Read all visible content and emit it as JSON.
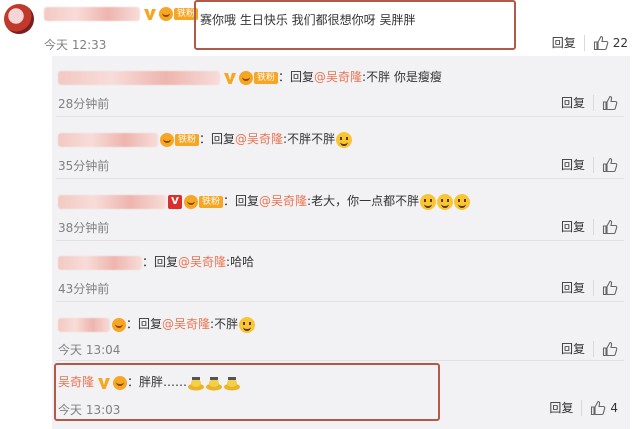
{
  "main_comment": {
    "username": "独上…",
    "text": "赛你哦 生日快乐 我们都很想你呀 吴胖胖",
    "time": "今天 12:33",
    "reply_label": "回复",
    "likes": "22"
  },
  "replies": [
    {
      "prefix": "：回复",
      "target": "@吴奇隆",
      "text": ":不胖 你是瘦瘦",
      "time": "28分钟前",
      "reply_label": "回复"
    },
    {
      "prefix": "：回复",
      "target": "@吴奇隆",
      "text": ":不胖不胖",
      "time": "35分钟前",
      "reply_label": "回复"
    },
    {
      "prefix": "：回复",
      "target": "@吴奇隆",
      "text": ":老大，你一点都不胖",
      "time": "38分钟前",
      "reply_label": "回复"
    },
    {
      "prefix": "：回复",
      "target": "@吴奇隆",
      "text": ":哈哈",
      "time": "43分钟前",
      "reply_label": "回复"
    },
    {
      "prefix": "：回复",
      "target": "@吴奇隆",
      "text": ":不胖",
      "time": "今天 13:04",
      "reply_label": "回复"
    },
    {
      "username": "吴奇隆",
      "text": "：胖胖……",
      "time": "今天 13:03",
      "reply_label": "回复",
      "likes": "4"
    }
  ],
  "badges": {
    "fan_label": "铁粉",
    "red_badge": "V"
  },
  "colors": {
    "accent": "#eb7350",
    "highlight_border": "#b05a4a",
    "reply_bg": "#f2f2f5"
  }
}
